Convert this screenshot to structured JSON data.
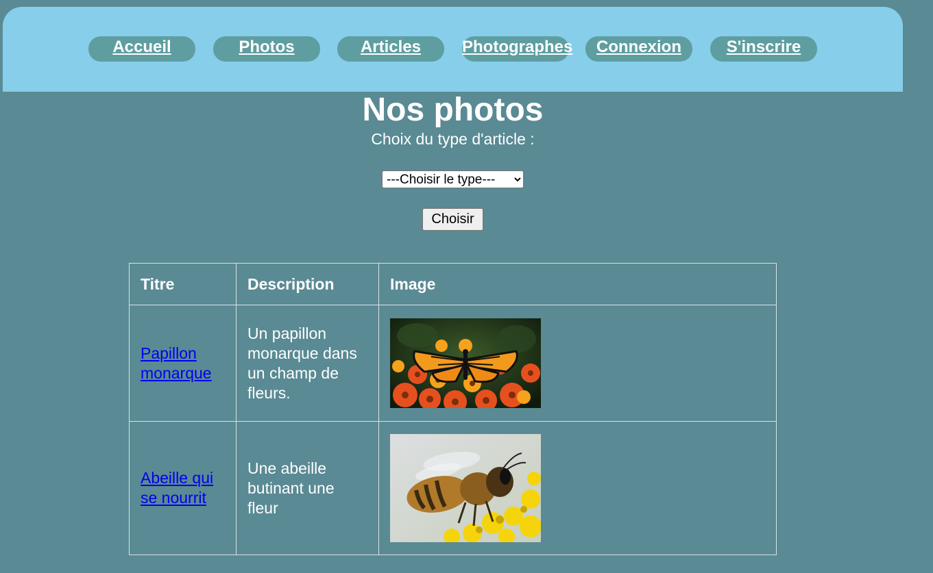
{
  "nav": {
    "items": [
      {
        "label": "Accueil"
      },
      {
        "label": "Photos"
      },
      {
        "label": "Articles"
      },
      {
        "label": "Photographes"
      },
      {
        "label": "Connexion"
      },
      {
        "label": "S'inscrire"
      }
    ]
  },
  "main": {
    "title": "Nos photos",
    "type_label": "Choix du type d'article :",
    "select_value": "---Choisir le type---",
    "choose_button": "Choisir"
  },
  "table": {
    "headers": [
      "Titre",
      "Description",
      "Image"
    ],
    "rows": [
      {
        "title": "Papillon monarque",
        "description": "Un papillon monarque dans un champ de fleurs.",
        "image": "monarch-butterfly-on-flowers"
      },
      {
        "title": "Abeille qui se nourrit",
        "description": "Une abeille butinant une fleur",
        "image": "bee-on-yellow-flower"
      }
    ]
  }
}
